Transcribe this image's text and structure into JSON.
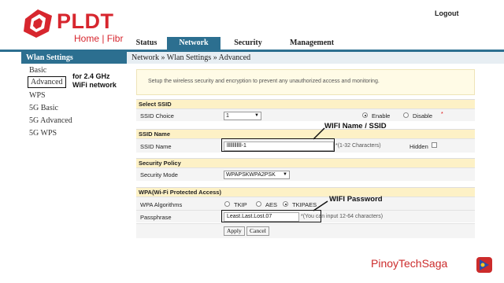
{
  "brand": {
    "name": "PLDT",
    "sub": "Home | Fibr",
    "color": "#d7262e"
  },
  "header": {
    "logout": "Logout"
  },
  "tabs": [
    {
      "label": "Status",
      "active": false
    },
    {
      "label": "Network",
      "active": true
    },
    {
      "label": "Security",
      "active": false
    },
    {
      "label": "Management",
      "active": false
    }
  ],
  "sidebar": {
    "title": "Wlan Settings",
    "items": [
      "Basic",
      "Advanced",
      "WPS",
      "5G Basic",
      "5G Advanced",
      "5G WPS"
    ],
    "selected": "Advanced",
    "note_line1": "for 2.4 GHz",
    "note_line2": "WiFi network"
  },
  "breadcrumb": "Network » Wlan Settings » Advanced",
  "info": "Setup the wireless security and encryption to prevent any unauthorized access and monitoring.",
  "select_ssid": {
    "title": "Select SSID",
    "label": "SSID Choice",
    "value": "1",
    "enable_label": "Enable",
    "disable_label": "Disable",
    "required": "*"
  },
  "ssid_name": {
    "title": "SSID Name",
    "label": "SSID Name",
    "value": "llllllllllll-1",
    "hint": "*(1-32 Characters)",
    "hidden_label": "Hidden"
  },
  "security_policy": {
    "title": "Security Policy",
    "label": "Security Mode",
    "value": "WPAPSKWPA2PSK"
  },
  "wpa": {
    "title": "WPA(Wi-Fi Protected Access)",
    "algorithms_label": "WPA Algorithms",
    "options": [
      "TKIP",
      "AES",
      "TKIPAES"
    ],
    "selected": "TKIPAES",
    "passphrase_label": "Passphrase",
    "passphrase_value": "Least.Last.Lost.07",
    "passphrase_hint": "*(You can input 12-64 characters)"
  },
  "buttons": {
    "apply": "Apply",
    "cancel": "Cancel"
  },
  "annotations": {
    "wifi_name": "WIFI Name / SSID",
    "wifi_password": "WIFI Password"
  },
  "watermark": "PinoyTechSaga",
  "colors": {
    "accent": "#2c6f90",
    "section": "#fdf1c6",
    "info_bg": "#fffbe6",
    "watermark": "#cc2b2b"
  }
}
